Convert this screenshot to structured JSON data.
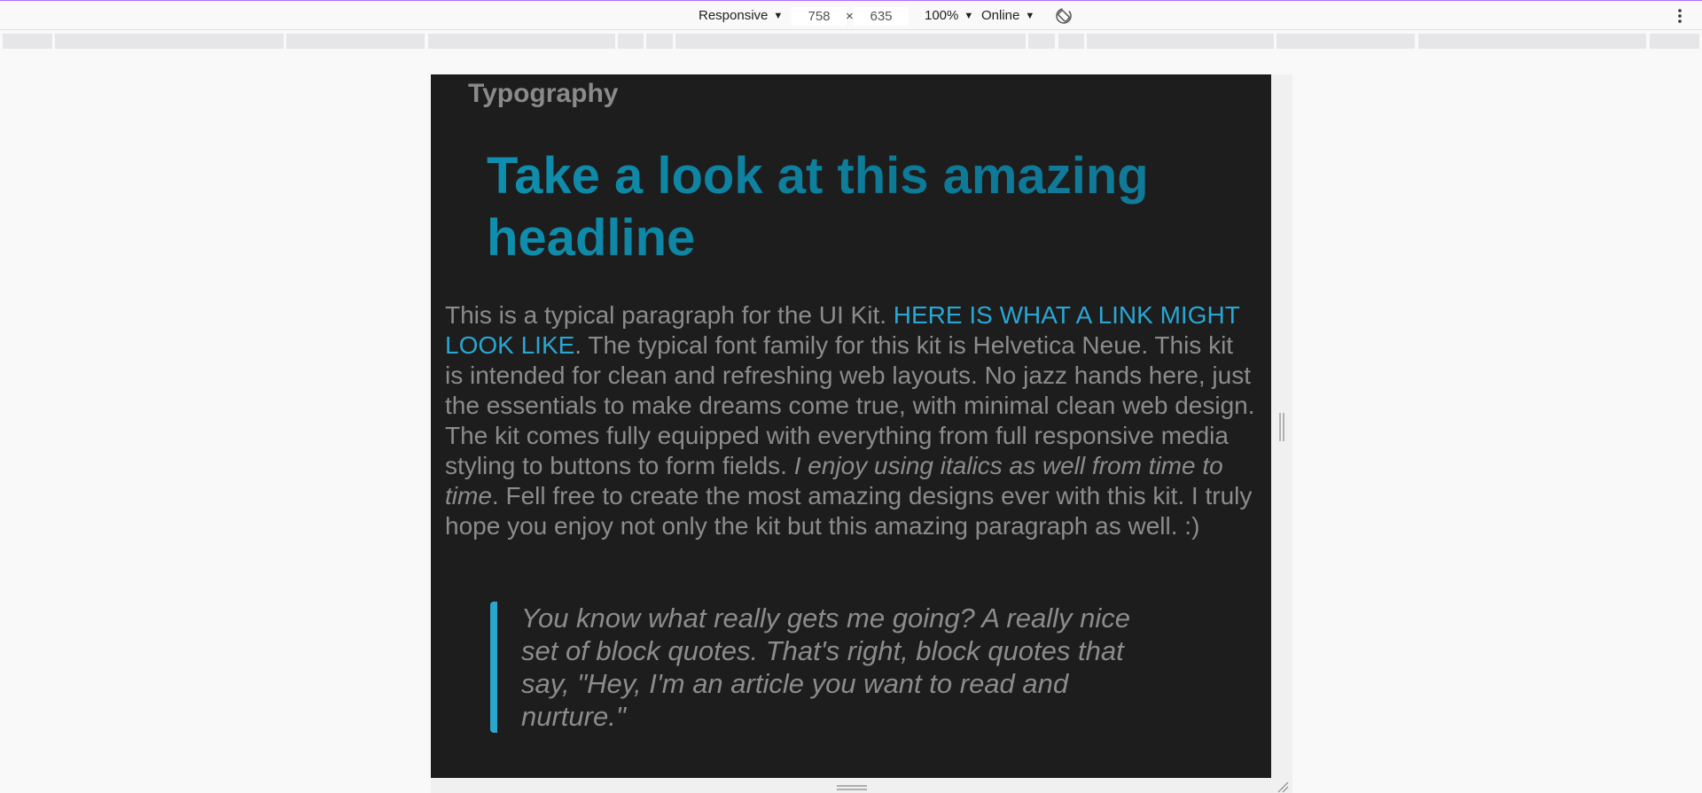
{
  "toolbar": {
    "device_mode": "Responsive",
    "width_value": "758",
    "height_value": "635",
    "times_sign": "×",
    "zoom": "100%",
    "network": "Online"
  },
  "page": {
    "section_title": "Typography",
    "headline": "Take a look at this amazing headline",
    "paragraph": {
      "intro": "This is a typical paragraph for the UI Kit. ",
      "link": "Here is what a link might look like",
      "middle": ". The typical font family for this kit is Helvetica Neue. This kit is intended for clean and refreshing web layouts. No jazz hands here, just the essentials to make dreams come true, with minimal clean web design. The kit comes fully equipped with everything from full responsive media styling to buttons to form fields. ",
      "italic": "I enjoy using italics as well from time to time",
      "outro": ". Fell free to create the most amazing designs ever with this kit. I truly hope you enjoy not only the kit but this amazing paragraph as well. :)"
    },
    "blockquote": "You know what really gets me going? A really nice set of block quotes. That's right, block quotes that say, \"Hey, I'm an article you want to read and nurture.\""
  },
  "colors": {
    "viewport_bg": "#1d1d1d",
    "heading": "#8a8a8a",
    "headline": "#0f8aa8",
    "text": "#8c8c8c",
    "link": "#2aa6d4",
    "quote_border": "#2ba7cf",
    "toolbar_accent": "#b56cf0"
  },
  "icons": {
    "rotate": "rotate-device-icon",
    "menu": "kebab-menu-icon"
  }
}
